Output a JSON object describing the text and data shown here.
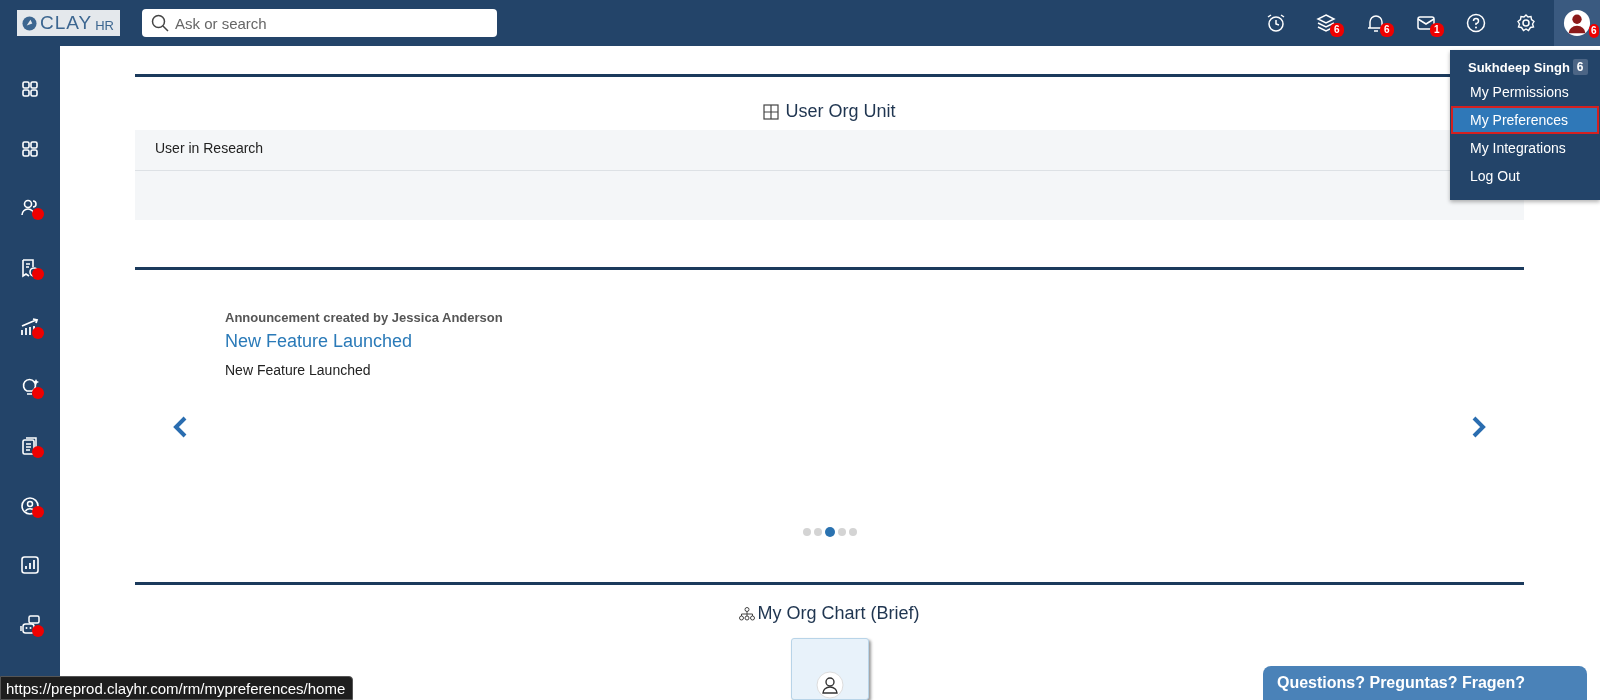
{
  "logo": {
    "text": "CLAY",
    "suffix": "HR"
  },
  "search": {
    "placeholder": "Ask or search"
  },
  "top_icons": [
    {
      "kind": "alarm"
    },
    {
      "kind": "layers",
      "badge": "6"
    },
    {
      "kind": "bell",
      "badge": "6"
    },
    {
      "kind": "mail",
      "badge": "1"
    },
    {
      "kind": "help"
    },
    {
      "kind": "settings"
    }
  ],
  "avatar": {
    "badge": "6"
  },
  "user_menu": {
    "name": "Sukhdeep Singh",
    "count": "6",
    "items": [
      {
        "label": "My Permissions",
        "selected": false
      },
      {
        "label": "My Preferences",
        "selected": true
      },
      {
        "label": "My Integrations",
        "selected": false
      },
      {
        "label": "Log Out",
        "selected": false
      }
    ]
  },
  "sidebar": {
    "items": [
      {
        "kind": "grid",
        "alert": false
      },
      {
        "kind": "grid",
        "alert": false
      },
      {
        "kind": "users",
        "alert": true
      },
      {
        "kind": "invoice",
        "alert": true
      },
      {
        "kind": "growth",
        "alert": true
      },
      {
        "kind": "bulb",
        "alert": true
      },
      {
        "kind": "docs",
        "alert": true
      },
      {
        "kind": "profile",
        "alert": true
      },
      {
        "kind": "chart",
        "alert": false
      },
      {
        "kind": "bot",
        "alert": true
      }
    ]
  },
  "org_unit": {
    "title": "User Org Unit",
    "rows": [
      "User in Research"
    ]
  },
  "announcement": {
    "byline": "Announcement created by Jessica Anderson",
    "title": "New Feature Launched",
    "body": "New Feature Launched",
    "dots": [
      {
        "selected": false
      },
      {
        "selected": false
      },
      {
        "selected": true
      },
      {
        "selected": false
      },
      {
        "selected": false
      }
    ]
  },
  "org_chart": {
    "title": "My Org Chart (Brief)"
  },
  "status_url": "https://preprod.clayhr.com/rm/mypreferences/home",
  "chat": {
    "label": "Questions? Preguntas? Fragen?"
  }
}
